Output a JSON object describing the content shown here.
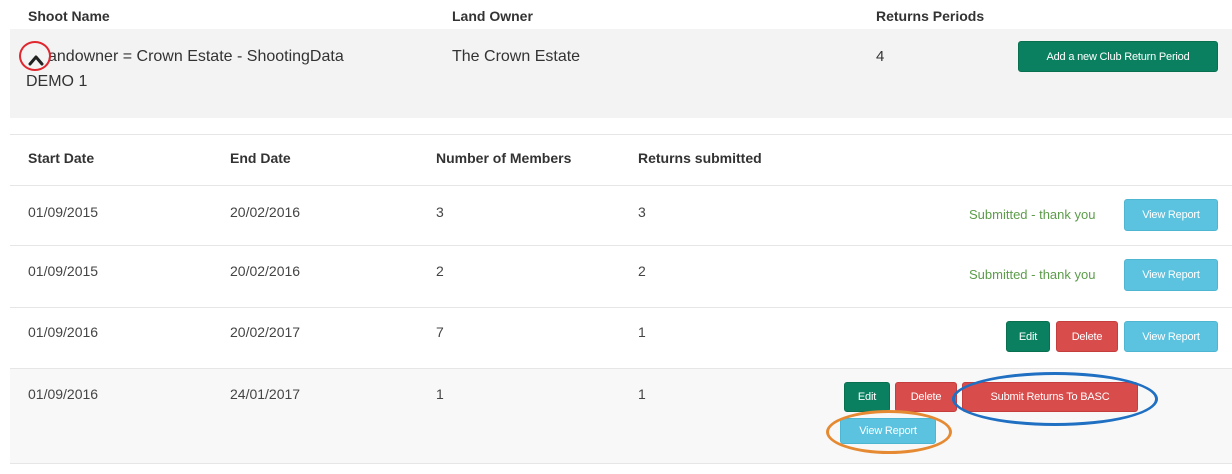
{
  "headers": {
    "shoot_name": "Shoot Name",
    "land_owner": "Land Owner",
    "returns_periods": "Returns Periods"
  },
  "shoot": {
    "name": "Landowner = Crown Estate - ShootingData DEMO 1",
    "name_line1": "andowner = Crown Estate - ShootingData",
    "name_line2": "DEMO 1",
    "land_owner": "The Crown Estate",
    "returns_periods": "4",
    "add_period_label": "Add a new Club Return Period",
    "toggle_icon": "chevron-up-icon"
  },
  "columns": {
    "start_date": "Start Date",
    "end_date": "End Date",
    "members": "Number of Members",
    "returns": "Returns submitted"
  },
  "periods": [
    {
      "start": "01/09/2015",
      "end": "20/02/2016",
      "members": "3",
      "returns": "3",
      "status": "Submitted - thank you",
      "view": "View Report"
    },
    {
      "start": "01/09/2015",
      "end": "20/02/2016",
      "members": "2",
      "returns": "2",
      "status": "Submitted - thank you",
      "view": "View Report"
    },
    {
      "start": "01/09/2016",
      "end": "20/02/2017",
      "members": "7",
      "returns": "1",
      "edit": "Edit",
      "delete": "Delete",
      "view": "View Report"
    },
    {
      "start": "01/09/2016",
      "end": "24/01/2017",
      "members": "1",
      "returns": "1",
      "edit": "Edit",
      "delete": "Delete",
      "submit": "Submit Returns To BASC",
      "view": "View Report"
    }
  ],
  "colors": {
    "green": "#0b8061",
    "red": "#d94c4c",
    "blue": "#5bc3df",
    "status_green": "#5c9c4a",
    "annotation_red": "#e0262e",
    "annotation_blue": "#1f6fc2",
    "annotation_orange": "#e58a32"
  }
}
